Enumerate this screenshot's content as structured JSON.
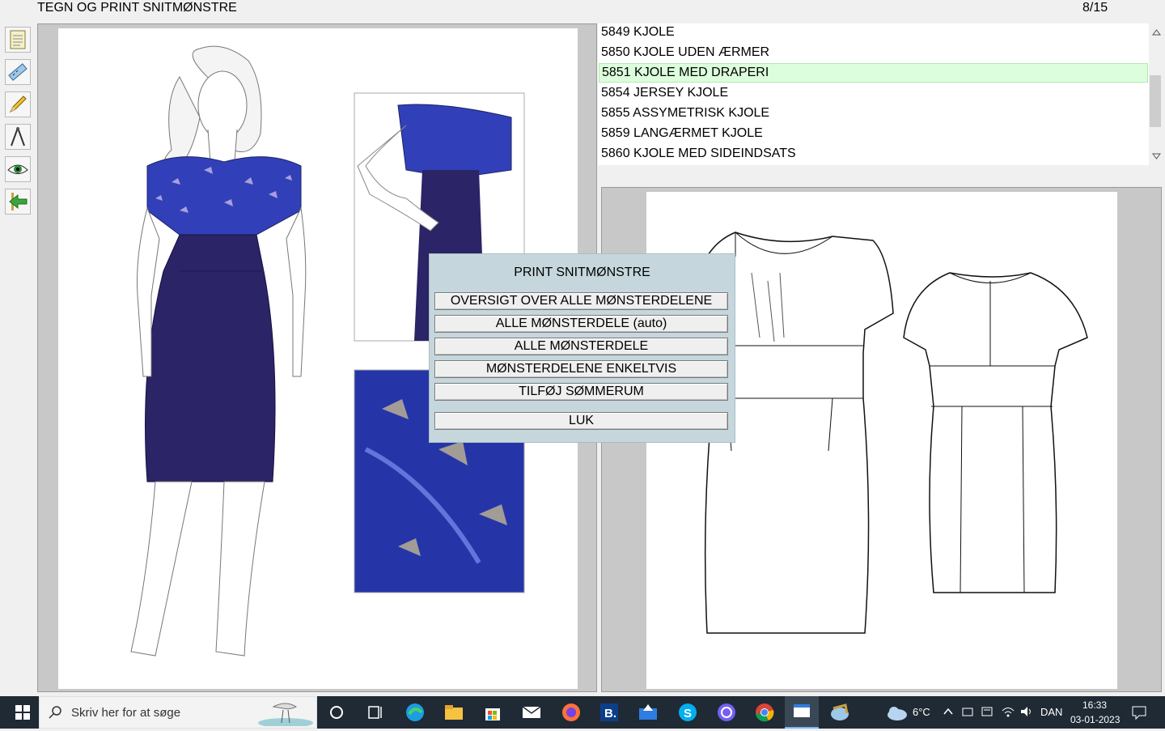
{
  "app": {
    "title": "TEGN OG PRINT SNITMØNSTRE",
    "page_counter": "8/15"
  },
  "toolbar": {
    "tools": [
      {
        "icon": "notepad-icon"
      },
      {
        "icon": "measure-tape-icon"
      },
      {
        "icon": "pencil-icon"
      },
      {
        "icon": "compass-icon"
      },
      {
        "icon": "eye-icon"
      },
      {
        "icon": "back-arrow-icon"
      }
    ]
  },
  "model_list": {
    "items": [
      {
        "label": "5849 KJOLE",
        "selected": false
      },
      {
        "label": "5850 KJOLE UDEN ÆRMER",
        "selected": false
      },
      {
        "label": "5851 KJOLE MED DRAPERI",
        "selected": true
      },
      {
        "label": "5854 JERSEY KJOLE",
        "selected": false
      },
      {
        "label": "5855 ASSYMETRISK KJOLE",
        "selected": false
      },
      {
        "label": "5859 LANGÆRMET KJOLE",
        "selected": false
      },
      {
        "label": "5860 KJOLE MED SIDEINDSATS",
        "selected": false
      }
    ]
  },
  "print_dialog": {
    "title": "PRINT SNITMØNSTRE",
    "buttons": [
      "OVERSIGT OVER ALLE MØNSTERDELENE",
      "ALLE MØNSTERDELE (auto)",
      "ALLE MØNSTERDELE",
      "MØNSTERDELENE ENKELTVIS",
      "TILFØJ SØMMERUM"
    ],
    "close_label": "LUK"
  },
  "colors": {
    "dress_navy": "#2b2466",
    "bodice_blue": "#3140b8",
    "selected_row": "#dcfedc",
    "dialog_bg": "#c5d7dc"
  },
  "taskbar": {
    "search_placeholder": "Skriv her for at søge",
    "weather": "6°C",
    "language": "DAN",
    "time": "16:33",
    "date": "03-01-2023"
  }
}
